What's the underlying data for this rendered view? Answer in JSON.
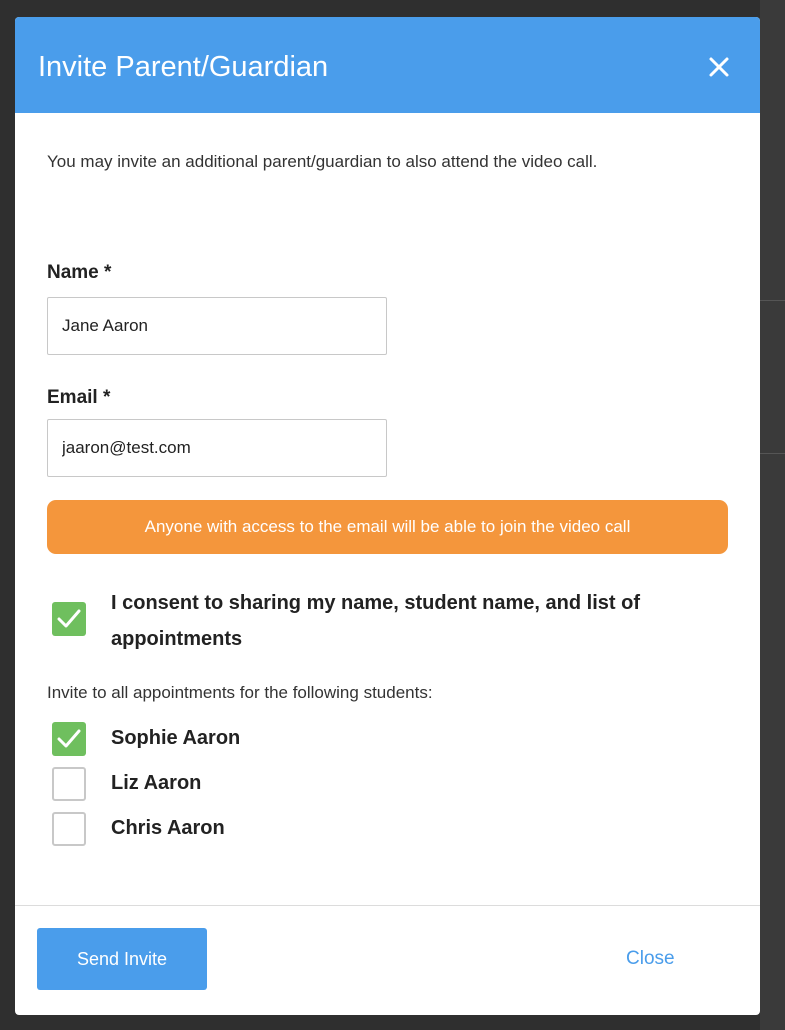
{
  "modal": {
    "title": "Invite Parent/Guardian",
    "close_icon": "close-icon",
    "intro_text": "You may invite an additional parent/guardian to also attend the video call."
  },
  "form": {
    "name_label": "Name *",
    "name_value": "Jane Aaron",
    "email_label": "Email *",
    "email_value": "jaaron@test.com"
  },
  "warning": {
    "text": "Anyone with access to the email will be able to join the video call",
    "color": "#f4963c"
  },
  "consent": {
    "label": "I consent to sharing my name, student name, and list of appointments",
    "checked": true
  },
  "students": {
    "heading": "Invite to all appointments for the following students:",
    "items": [
      {
        "name": "Sophie Aaron",
        "checked": true
      },
      {
        "name": "Liz Aaron",
        "checked": false
      },
      {
        "name": "Chris Aaron",
        "checked": false
      }
    ]
  },
  "footer": {
    "send_label": "Send Invite",
    "close_label": "Close"
  },
  "colors": {
    "primary": "#4a9deb",
    "checked": "#6fbf5e",
    "warning": "#f4963c"
  }
}
